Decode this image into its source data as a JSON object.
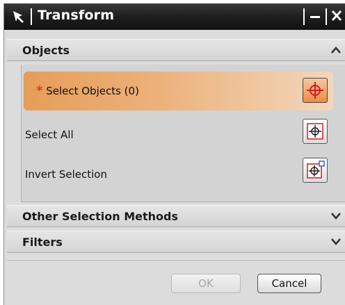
{
  "window": {
    "title": "Transform"
  },
  "sections": {
    "objects": {
      "title": "Objects",
      "expanded": true
    },
    "other_selection": {
      "title": "Other Selection Methods",
      "expanded": false
    },
    "filters": {
      "title": "Filters",
      "expanded": false
    }
  },
  "rows": {
    "select_objects": {
      "required_marker": "*",
      "label": "Select Objects (0)"
    },
    "select_all": {
      "label": "Select All"
    },
    "invert_selection": {
      "label": "Invert Selection"
    }
  },
  "buttons": {
    "ok": "OK",
    "cancel": "Cancel"
  },
  "colors": {
    "titlebar": "#1e1e1e",
    "active_row": "#e69d58",
    "required_star": "#e8341c",
    "crosshair": "#cc1f1f"
  },
  "icons": {
    "title": "select-arrow-icon",
    "collapse": "chevron-up-icon",
    "expand": "chevron-down-icon",
    "pick": "crosshair-icon"
  }
}
